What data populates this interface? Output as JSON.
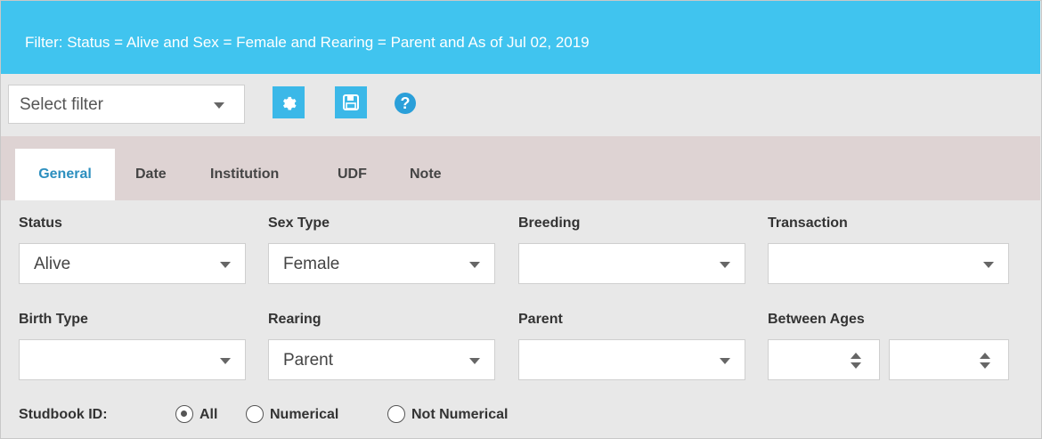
{
  "header": {
    "filter_text": "Filter: Status = Alive and Sex = Female and Rearing = Parent and As of Jul 02, 2019"
  },
  "toolbar": {
    "select_filter_value": "Select filter",
    "buttons": [
      {
        "name": "settings-button",
        "icon": "gear-icon"
      },
      {
        "name": "save-button",
        "icon": "floppy-disk-icon"
      }
    ],
    "help_icon_glyph": "?"
  },
  "tabs": [
    {
      "label": "General",
      "active": true
    },
    {
      "label": "Date",
      "active": false
    },
    {
      "label": "Institution",
      "active": false
    },
    {
      "label": "UDF",
      "active": false
    },
    {
      "label": "Note",
      "active": false
    }
  ],
  "fields": {
    "status": {
      "label": "Status",
      "value": "Alive"
    },
    "sex_type": {
      "label": "Sex Type",
      "value": "Female"
    },
    "breeding": {
      "label": "Breeding",
      "value": ""
    },
    "transaction": {
      "label": "Transaction",
      "value": ""
    },
    "birth_type": {
      "label": "Birth Type",
      "value": ""
    },
    "rearing": {
      "label": "Rearing",
      "value": "Parent"
    },
    "parent": {
      "label": "Parent",
      "value": ""
    },
    "between_ages": {
      "label": "Between Ages",
      "min": "",
      "max": ""
    }
  },
  "studbook": {
    "label": "Studbook ID:",
    "options": [
      {
        "label": "All",
        "checked": true
      },
      {
        "label": "Numerical",
        "checked": false
      },
      {
        "label": "Not Numerical",
        "checked": false
      }
    ]
  },
  "colors": {
    "header_bg": "#40c4ef",
    "button_bg": "#3bb8e8",
    "active_tab_text": "#2c8fbf",
    "tabbar_bg": "#ded3d3"
  }
}
